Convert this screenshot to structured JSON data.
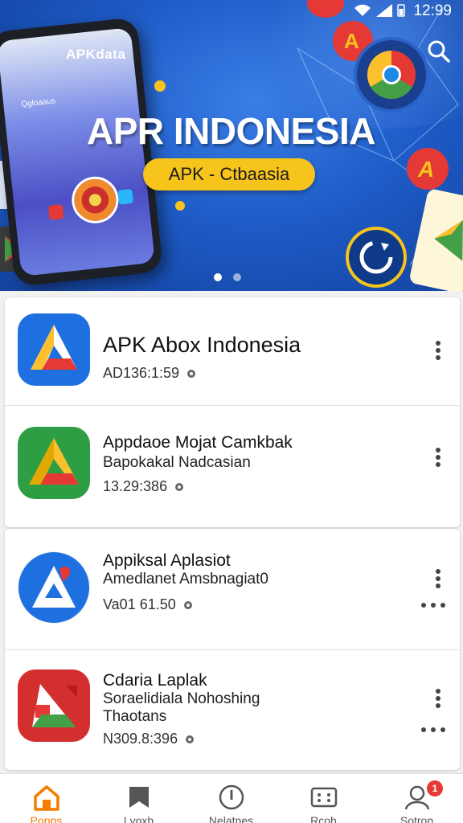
{
  "status_bar": {
    "time": "12:99"
  },
  "banner": {
    "brand": "APKdata",
    "phone_title": "Qgloaaus",
    "title": "APR INDONESIA",
    "subtitle": "APK - Ctbaasia",
    "search_icon": "search-icon",
    "carousel_pages": 2,
    "carousel_active": 1
  },
  "apps": [
    {
      "name": "APK Abox Indonesia",
      "sub": "",
      "meta": "AD136:1:59",
      "icon": "apk-triangle-blue"
    },
    {
      "name": "Appdaoe Mojat Camkbak",
      "sub": "Bapokakal Nadcasian",
      "meta": "13.29:386",
      "icon": "apk-triangle-green"
    },
    {
      "name": "Appiksal Aplasiot",
      "sub": "Amedlanet Amsbnagiat0",
      "meta": "Va01 61.50",
      "icon": "apk-triangle-blue-circle"
    },
    {
      "name": "Cdaria Laplak",
      "sub": "Soraelidiala Nohoshing",
      "sub2": "Thaotans",
      "meta": "N309.8:396",
      "icon": "apk-triangle-red"
    }
  ],
  "nav": {
    "items": [
      {
        "label": "Popps",
        "icon": "home-icon"
      },
      {
        "label": "Lvoxh",
        "icon": "bookmark-icon"
      },
      {
        "label": "Nelatnes",
        "icon": "alert-icon"
      },
      {
        "label": "Rcoh",
        "icon": "grid-icon"
      },
      {
        "label": "Sotron",
        "icon": "profile-icon",
        "badge": "1"
      }
    ]
  },
  "colors": {
    "accent": "#f57c00",
    "banner": "#1e5cc8",
    "pill": "#f7c41c",
    "badge": "#e53935"
  }
}
